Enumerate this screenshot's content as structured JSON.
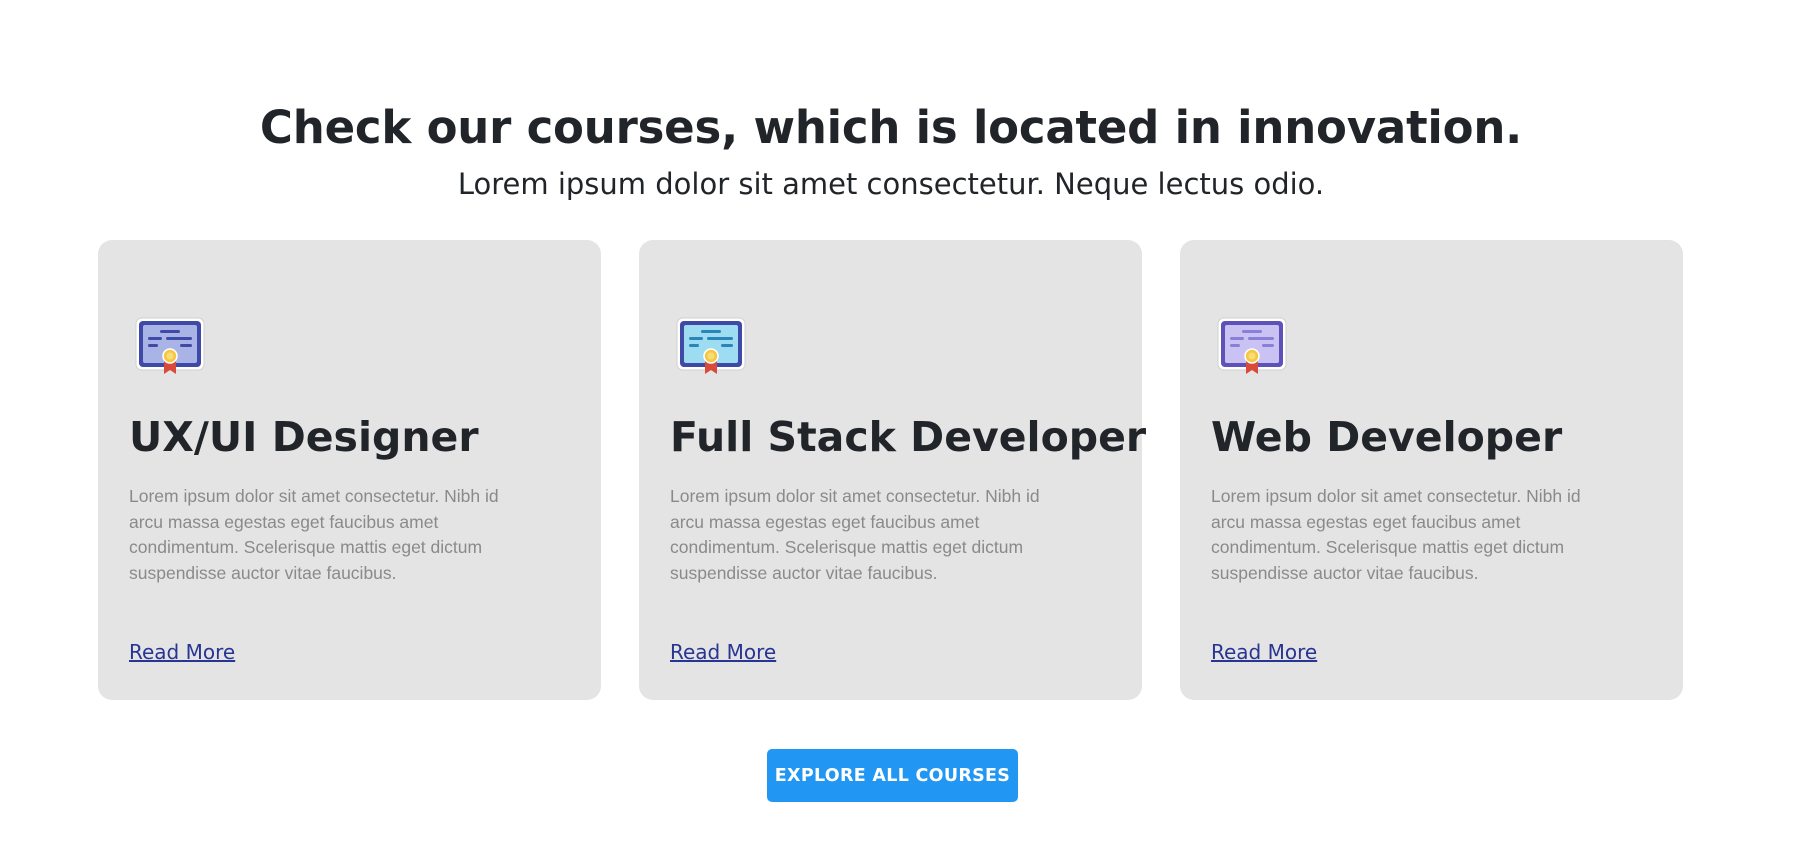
{
  "header": {
    "title": "Check our courses, which is located in innovation.",
    "subtitle": "Lorem ipsum dolor sit amet consectetur. Neque lectus odio."
  },
  "courses": [
    {
      "icon": "certificate-icon",
      "icon_color": "#3f4aa8",
      "icon_panel": "#a9b3e6",
      "title": "UX/UI Designer",
      "description": "Lorem ipsum dolor sit amet consectetur. Nibh id arcu massa egestas eget faucibus amet condimentum. Scelerisque mattis eget dictum suspendisse auctor vitae faucibus.",
      "link": "Read More"
    },
    {
      "icon": "certificate-icon",
      "icon_color": "#3f4aa8",
      "icon_panel": "#9edcf2",
      "title": "Full Stack Developer",
      "description": "Lorem ipsum dolor sit amet consectetur. Nibh id arcu massa egestas eget faucibus amet condimentum. Scelerisque mattis eget dictum suspendisse auctor vitae faucibus.",
      "link": "Read More"
    },
    {
      "icon": "certificate-icon",
      "icon_color": "#5e52b8",
      "icon_panel": "#c9c2f2",
      "title": "Web Developer",
      "description": "Lorem ipsum dolor sit amet consectetur. Nibh id arcu massa egestas eget faucibus amet condimentum. Scelerisque mattis eget dictum suspendisse auctor vitae faucibus.",
      "link": "Read More"
    }
  ],
  "cta": {
    "label": "EXPLORE ALL COURSES"
  },
  "colors": {
    "card_bg": "#e4e4e4",
    "link": "#283593",
    "button_bg": "#2196f3"
  }
}
